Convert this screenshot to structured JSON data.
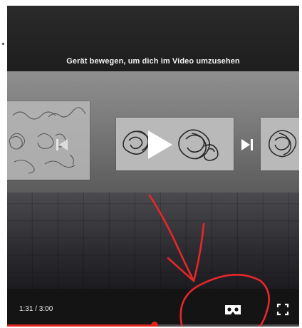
{
  "player": {
    "hint_text": "Gerät bewegen, um dich im Video umzusehen",
    "time_display": "1:31 / 3:00",
    "progress_fraction": 0.505
  },
  "controls": {
    "previous": {
      "icon": "skip-previous-icon"
    },
    "play": {
      "icon": "play-icon"
    },
    "next": {
      "icon": "skip-next-icon"
    },
    "vr": {
      "icon": "cardboard-vr-icon"
    },
    "fullscreen": {
      "icon": "fullscreen-icon"
    }
  },
  "colors": {
    "progress": "#e0231f",
    "annotation": "#e8262b"
  }
}
